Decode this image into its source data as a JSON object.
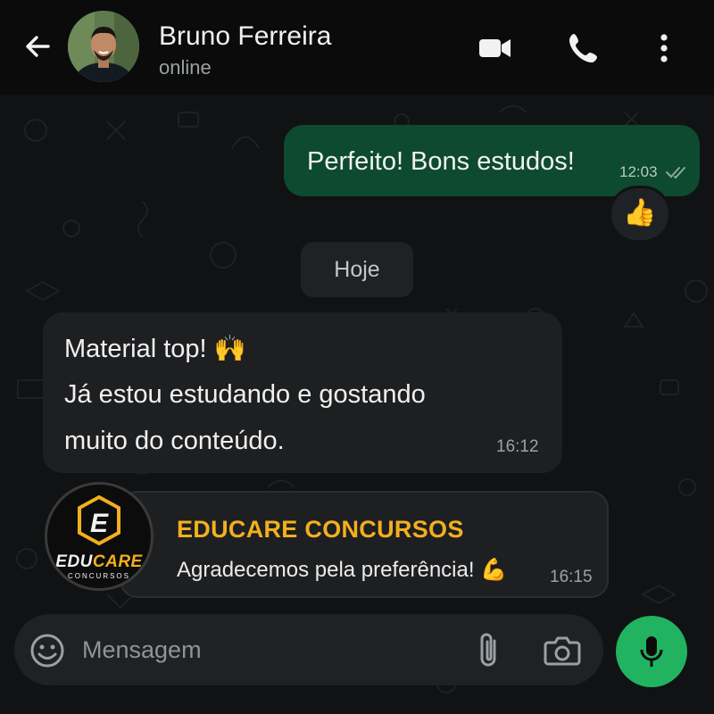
{
  "header": {
    "back_icon": "arrow-left-icon",
    "contact_name": "Bruno Ferreira",
    "status": "online",
    "video_icon": "video-camera-icon",
    "call_icon": "phone-icon",
    "menu_icon": "more-vertical-icon"
  },
  "messages": {
    "outgoing": {
      "text": "Perfeito! Bons estudos!",
      "time": "12:03",
      "reaction": "👍"
    },
    "date_separator": "Hoje",
    "incoming": {
      "lines": [
        "Material top! 🙌",
        "Já estou estudando e gostando",
        "muito do conteúdo."
      ],
      "time": "16:12"
    },
    "business_card": {
      "logo_letter": "E",
      "logo_word_1": "EDU",
      "logo_word_2": "CARE",
      "logo_sub": "CONCURSOS",
      "title": "EDUCARE CONCURSOS",
      "text": "Agradecemos pela preferência! 💪",
      "time": "16:15"
    }
  },
  "composer": {
    "placeholder": "Mensagem",
    "emoji_icon": "emoji-icon",
    "attach_icon": "paperclip-icon",
    "camera_icon": "camera-icon",
    "mic_icon": "microphone-icon"
  },
  "colors": {
    "outgoing_bubble": "#0d4a2f",
    "incoming_bubble": "#1e1f21",
    "accent_green": "#22b361",
    "brand_yellow": "#f2b01e"
  }
}
